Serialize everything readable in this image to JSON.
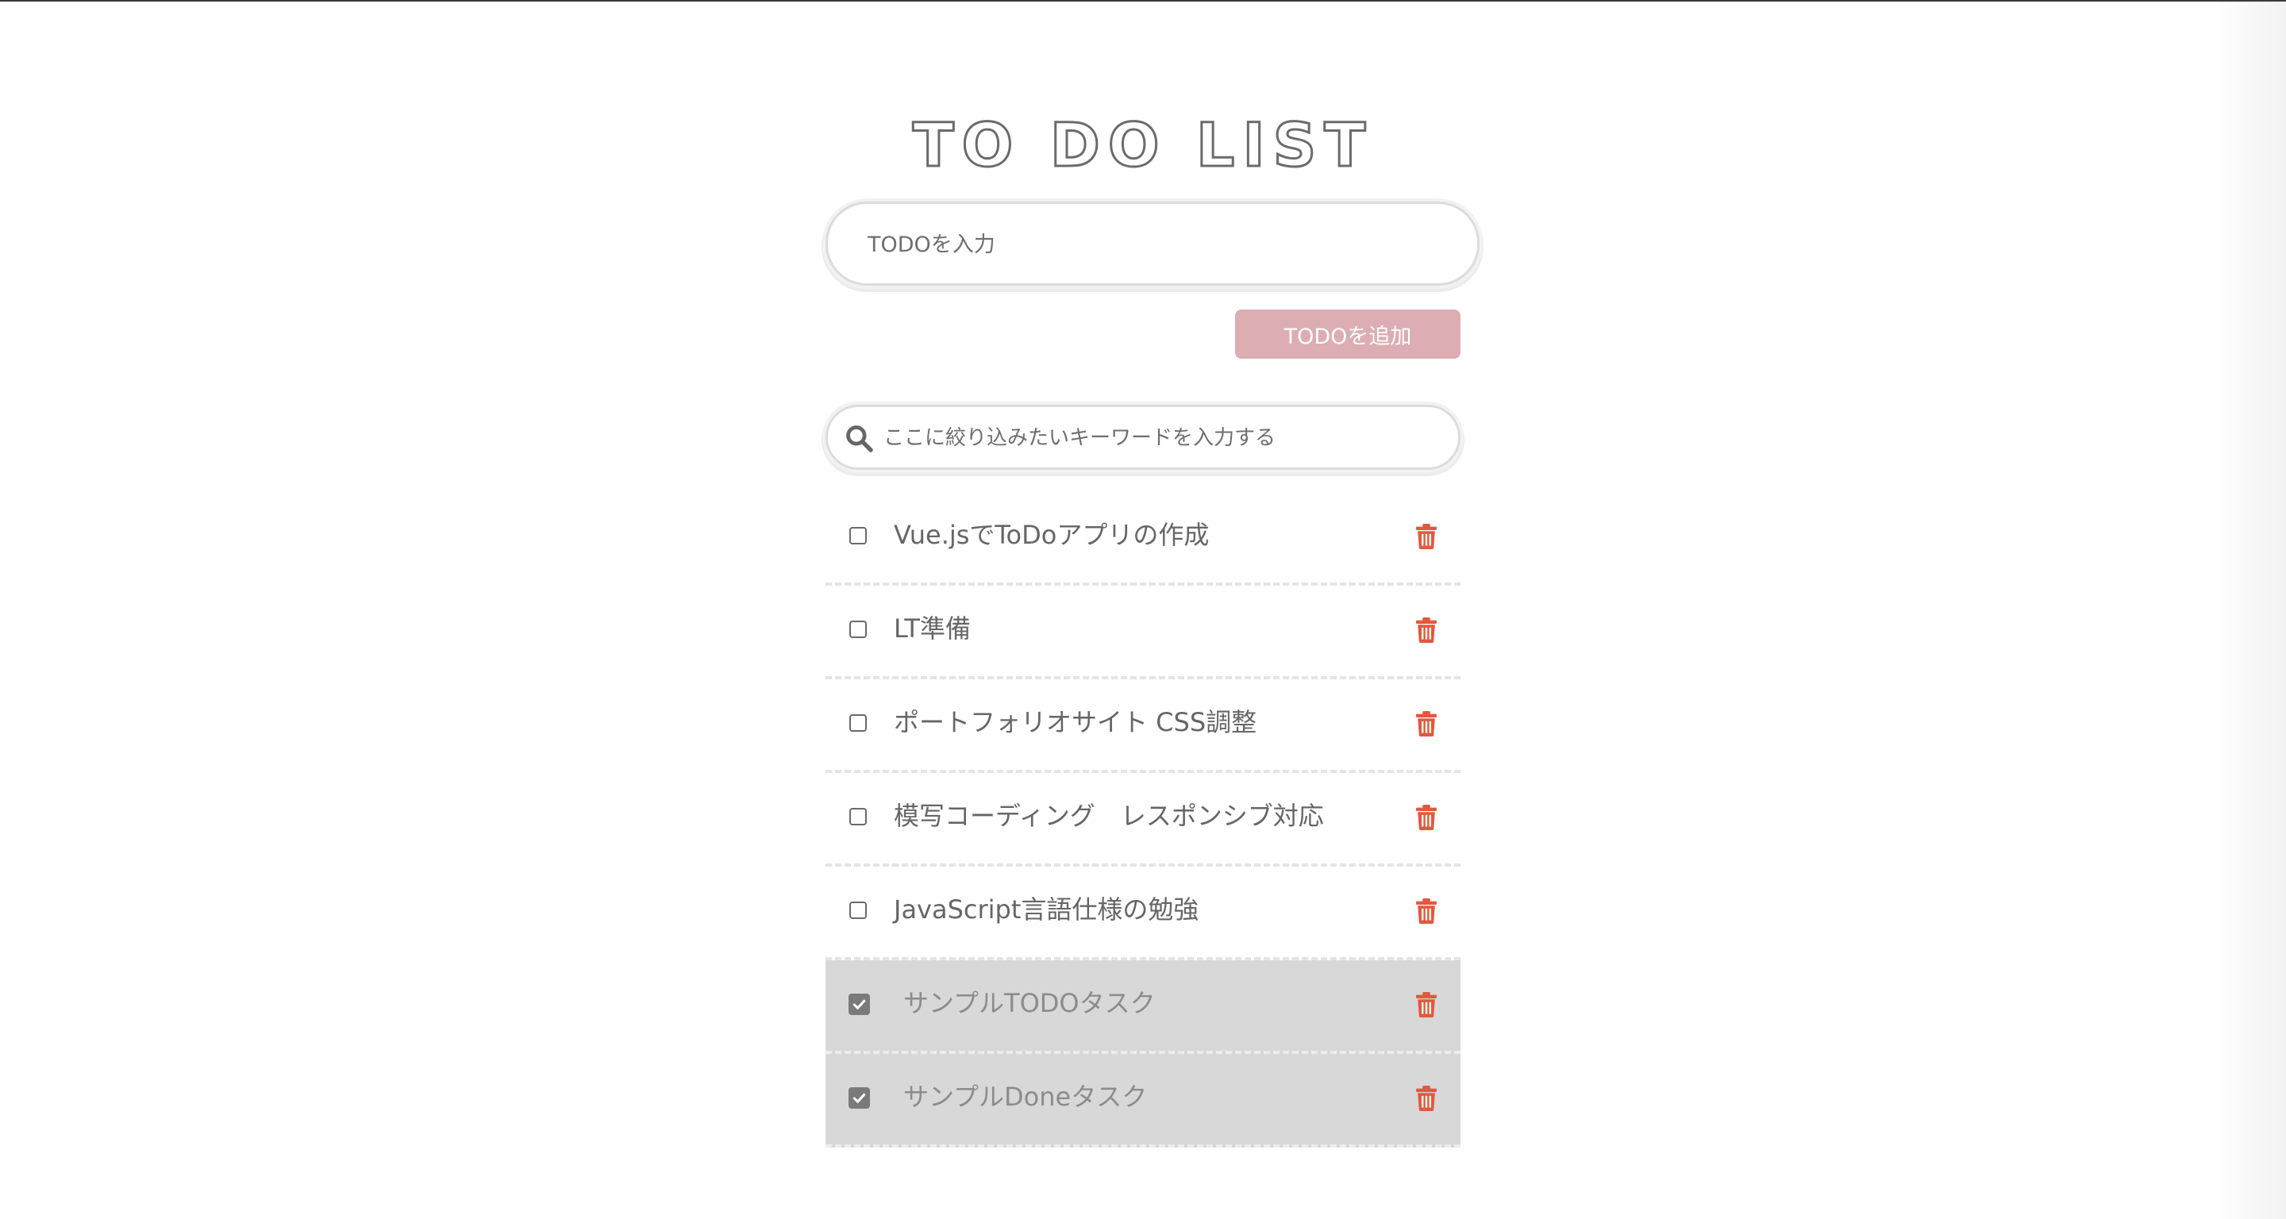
{
  "app": {
    "title": "TO DO LIST"
  },
  "new_todo": {
    "placeholder": "TODOを入力",
    "value": "",
    "add_label": "TODOを追加"
  },
  "filter": {
    "placeholder": "ここに絞り込みたいキーワードを入力する",
    "value": ""
  },
  "colors": {
    "accent_button": "#dcadb3",
    "delete_icon": "#e2583e",
    "done_row": "#d8d8d8",
    "text": "#666666"
  },
  "icons": {
    "search": "search-icon",
    "delete": "trash-icon",
    "checked": "check-icon"
  },
  "todos": [
    {
      "label": "Vue.jsでToDoアプリの作成",
      "done": false
    },
    {
      "label": "LT準備",
      "done": false
    },
    {
      "label": "ポートフォリオサイト CSS調整",
      "done": false
    },
    {
      "label": "模写コーディング　レスポンシブ対応",
      "done": false
    },
    {
      "label": "JavaScript言語仕様の勉強",
      "done": false
    },
    {
      "label": "サンプルTODOタスク",
      "done": true
    },
    {
      "label": "サンプルDoneタスク",
      "done": true
    }
  ]
}
